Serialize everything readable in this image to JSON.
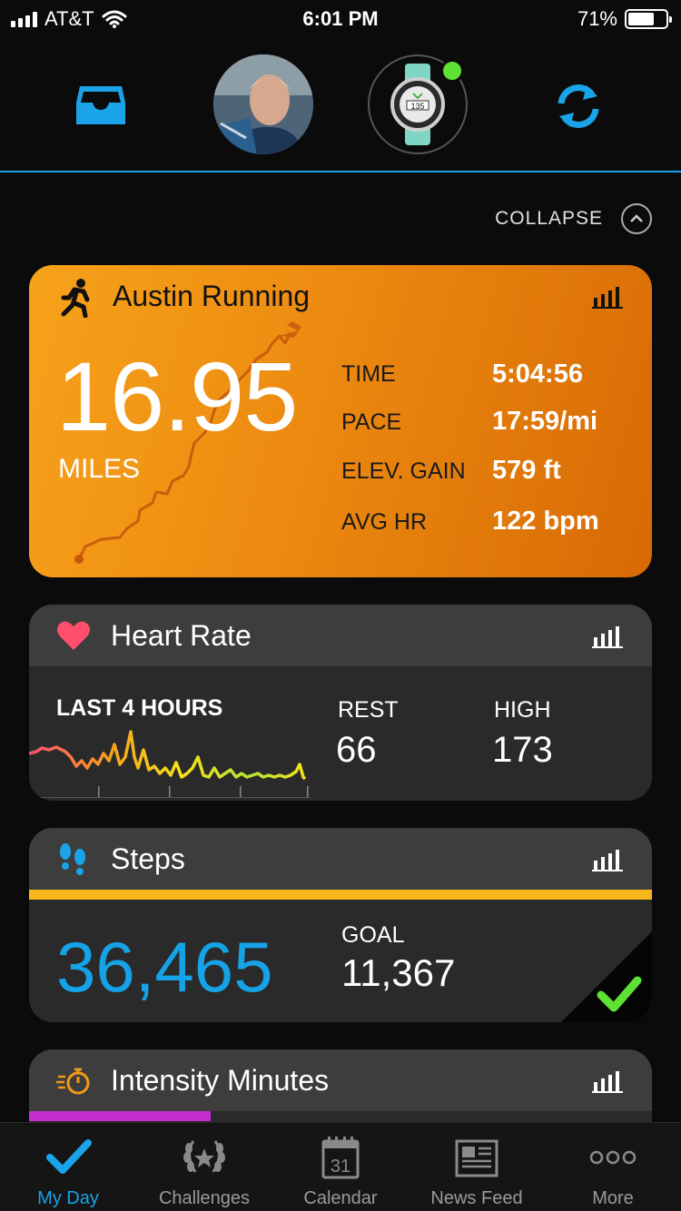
{
  "status_bar": {
    "carrier": "AT&T",
    "time": "6:01 PM",
    "battery": "71%",
    "battery_level": 0.71
  },
  "header": {
    "collapse_label": "COLLAPSE"
  },
  "activity": {
    "title": "Austin Running",
    "distance": "16.95",
    "distance_unit": "MILES",
    "stats": [
      {
        "label": "TIME",
        "value": "5:04:56"
      },
      {
        "label": "PACE",
        "value": "17:59/mi"
      },
      {
        "label": "ELEV. GAIN",
        "value": "579 ft"
      },
      {
        "label": "AVG HR",
        "value": "122 bpm"
      }
    ]
  },
  "heart_rate": {
    "title": "Heart Rate",
    "period": "LAST 4 HOURS",
    "rest_label": "REST",
    "rest_value": "66",
    "high_label": "HIGH",
    "high_value": "173"
  },
  "steps": {
    "title": "Steps",
    "value": "36,465",
    "goal_label": "GOAL",
    "goal_value": "11,367",
    "progress": 1.0
  },
  "intensity": {
    "title": "Intensity Minutes"
  },
  "tabs": [
    {
      "label": "My Day",
      "icon": "checkmark-icon",
      "active": true
    },
    {
      "label": "Challenges",
      "icon": "laurel-icon",
      "active": false
    },
    {
      "label": "Calendar",
      "icon": "calendar-icon",
      "date": "31",
      "active": false
    },
    {
      "label": "News Feed",
      "icon": "newspaper-icon",
      "active": false
    },
    {
      "label": "More",
      "icon": "more-dots-icon",
      "active": false
    }
  ],
  "colors": {
    "accent": "#1aa3e8",
    "activity_orange": "#f29a17",
    "heart": "#ff4f6d",
    "steps_yellow": "#f8b81c",
    "success_green": "#5fe035",
    "intensity_purple": "#c52fcf"
  }
}
